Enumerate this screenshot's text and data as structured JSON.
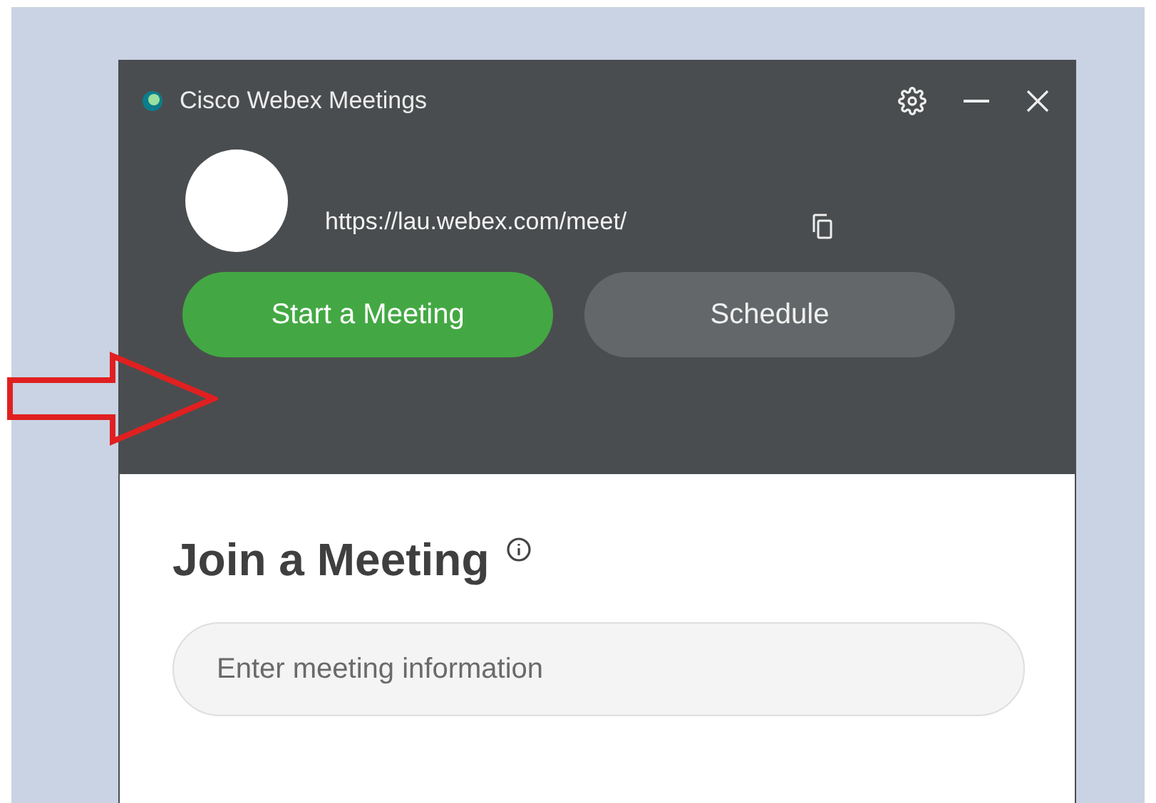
{
  "window": {
    "title": "Cisco Webex Meetings"
  },
  "profile": {
    "url": "https://lau.webex.com/meet/"
  },
  "actions": [
    {
      "label": "Start a Meeting",
      "kind": "primary"
    },
    {
      "label": "Schedule",
      "kind": "secondary"
    }
  ],
  "join": {
    "heading": "Join a Meeting",
    "placeholder": "Enter meeting information"
  }
}
